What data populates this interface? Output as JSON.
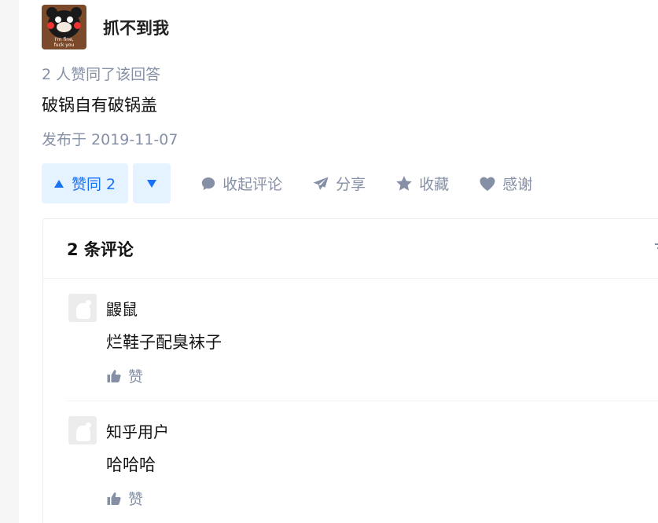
{
  "author": {
    "name": "抓不到我",
    "avatar_caption": "I'm fine,\nfuck you"
  },
  "answer": {
    "vote_count_text": "2 人赞同了该回答",
    "content": "破锅自有破锅盖",
    "published": "发布于 2019-11-07"
  },
  "actions": {
    "upvote_label": "赞同 2",
    "comments_label": "收起评论",
    "share_label": "分享",
    "collect_label": "收藏",
    "thanks_label": "感谢"
  },
  "comments": {
    "title": "2 条评论",
    "items": [
      {
        "user": "鼹鼠",
        "text": "烂鞋子配臭袜子",
        "like_label": "赞"
      },
      {
        "user": "知乎用户",
        "text": "哈哈哈",
        "like_label": "赞"
      }
    ]
  },
  "colors": {
    "accent": "#1772f6",
    "accent_bg": "#e5f2ff",
    "meta_gray": "#8590a6",
    "text": "#121212"
  },
  "icons": [
    "triangle-up-icon",
    "triangle-down-icon",
    "comment-bubble-icon",
    "paper-plane-icon",
    "star-icon",
    "heart-icon",
    "thumbs-up-icon",
    "sort-icon"
  ]
}
